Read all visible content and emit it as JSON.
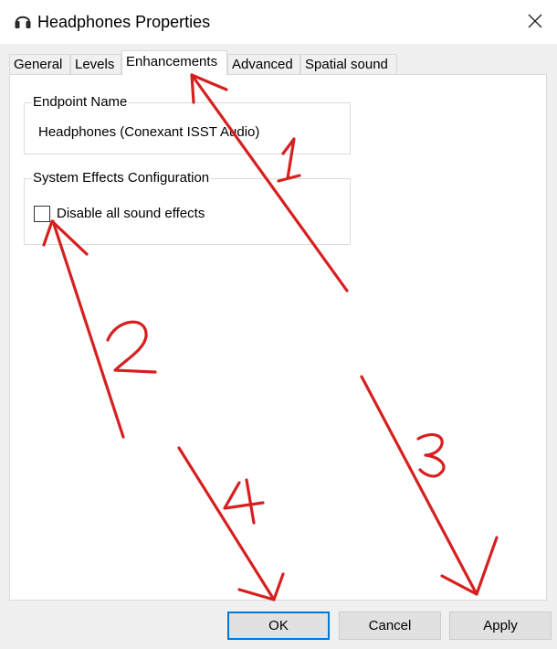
{
  "window": {
    "title": "Headphones Properties",
    "close_label": "✕"
  },
  "tabs": [
    {
      "label": "General",
      "active": false
    },
    {
      "label": "Levels",
      "active": false
    },
    {
      "label": "Enhancements",
      "active": true
    },
    {
      "label": "Advanced",
      "active": false
    },
    {
      "label": "Spatial sound",
      "active": false
    }
  ],
  "endpoint": {
    "group_title": "Endpoint Name",
    "value": "Headphones (Conexant ISST Audio)"
  },
  "system_effects": {
    "group_title": "System Effects Configuration",
    "checkbox_label": "Disable all sound effects",
    "checked": false
  },
  "buttons": {
    "ok": "OK",
    "cancel": "Cancel",
    "apply": "Apply"
  },
  "annotations": {
    "color": "#d62020",
    "labels": [
      "1",
      "2",
      "3",
      "4"
    ]
  },
  "colors": {
    "focus_border": "#0078d7",
    "button_face": "#e1e1e1",
    "dialog_background": "#f0f0f0"
  }
}
